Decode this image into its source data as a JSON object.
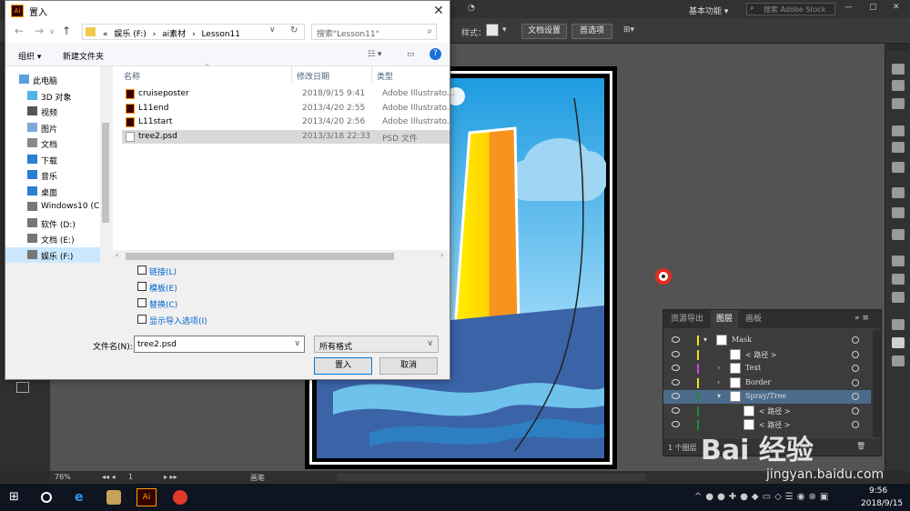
{
  "dialog": {
    "title": "置入",
    "nav": {
      "path": [
        "«",
        "娱乐 (F:)",
        "›",
        "ai素材",
        "›",
        "Lesson11"
      ],
      "search_placeholder": "搜索\"Lesson11\""
    },
    "toolbar": {
      "organize": "组织 ▾",
      "new_folder": "新建文件夹"
    },
    "tree": [
      {
        "label": "此电脑",
        "icon": "pc-icon",
        "indent": 0
      },
      {
        "label": "3D 对象",
        "icon": "3d-objects-icon",
        "indent": 1
      },
      {
        "label": "视频",
        "icon": "video-icon",
        "indent": 1
      },
      {
        "label": "图片",
        "icon": "pictures-icon",
        "indent": 1
      },
      {
        "label": "文档",
        "icon": "documents-icon",
        "indent": 1
      },
      {
        "label": "下载",
        "icon": "download-icon",
        "indent": 1
      },
      {
        "label": "音乐",
        "icon": "music-icon",
        "indent": 1
      },
      {
        "label": "桌面",
        "icon": "desktop-icon",
        "indent": 1
      },
      {
        "label": "Windows10 (C:",
        "icon": "drive-icon",
        "indent": 1
      },
      {
        "label": "软件 (D:)",
        "icon": "drive-icon",
        "indent": 1
      },
      {
        "label": "文档 (E:)",
        "icon": "drive-icon",
        "indent": 1
      },
      {
        "label": "娱乐 (F:)",
        "icon": "drive-icon",
        "indent": 1,
        "selected": true
      }
    ],
    "columns": {
      "name": "名称",
      "date": "修改日期",
      "type": "类型"
    },
    "files": [
      {
        "name": "cruiseposter",
        "date": "2018/9/15 9:41",
        "type": "Adobe Illustrato...",
        "icon": "ai-file-icon"
      },
      {
        "name": "L11end",
        "date": "2013/4/20 2:55",
        "type": "Adobe Illustrato...",
        "icon": "ai-file-icon"
      },
      {
        "name": "L11start",
        "date": "2013/4/20 2:56",
        "type": "Adobe Illustrato...",
        "icon": "ai-file-icon"
      },
      {
        "name": "tree2.psd",
        "date": "2013/3/18 22:33",
        "type": "PSD 文件",
        "icon": "psd-file-icon",
        "selected": true
      }
    ],
    "options": [
      "链接(L)",
      "模板(E)",
      "替换(C)",
      "显示导入选项(I)"
    ],
    "filename_label": "文件名(N):",
    "filename_value": "tree2.psd",
    "filetype_value": "所有格式",
    "ok_label": "置入",
    "cancel_label": "取消"
  },
  "illustrator": {
    "workspace": "基本功能 ▾",
    "stock_search": "搜索 Adobe Stock",
    "style_label": "样式：",
    "doc_setup": "文档设置",
    "preferences": "首选项",
    "zoom": "76%",
    "artboard_num": "1",
    "status_tool": "画笔"
  },
  "layers_panel": {
    "tabs": [
      "资源导出",
      "图层",
      "画板"
    ],
    "active_tab": "图层",
    "rows": [
      {
        "name": "Mask",
        "color": "#f2e21a",
        "level": 0,
        "arrow": "▾"
      },
      {
        "name": "< 路径 >",
        "color": "#f2e21a",
        "level": 1,
        "arrow": ""
      },
      {
        "name": "Text",
        "color": "#c44bd6",
        "level": 1,
        "arrow": "›"
      },
      {
        "name": "Border",
        "color": "#f2e21a",
        "level": 1,
        "arrow": "›"
      },
      {
        "name": "Spray/Tree",
        "color": "#1f8a3a",
        "level": 1,
        "arrow": "▾",
        "selected": true
      },
      {
        "name": "< 路径 >",
        "color": "#1f8a3a",
        "level": 2,
        "arrow": ""
      },
      {
        "name": "< 路径 >",
        "color": "#1f8a3a",
        "level": 2,
        "arrow": ""
      }
    ],
    "footer": "1 个图层"
  },
  "taskbar": {
    "time": "9:56",
    "date": "2018/9/15"
  },
  "watermark": {
    "logo": "Bai 经验",
    "url": "jingyan.baidu.com"
  }
}
